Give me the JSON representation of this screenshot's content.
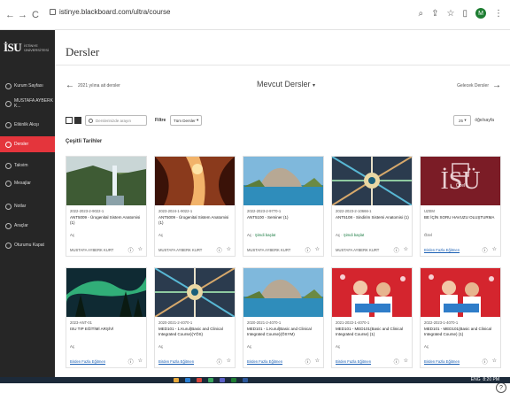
{
  "browser": {
    "url": "istinye.blackboard.com/ultra/course",
    "back": "←",
    "forward": "→",
    "reload": "C",
    "avatar_initial": "M"
  },
  "sidebar": {
    "logo_text": "İSU",
    "logo_sub_1": "İSTİNYE",
    "logo_sub_2": "ÜNİVERSİTESİ",
    "items": [
      {
        "label": "Kurum Sayfası"
      },
      {
        "label": "MUSTAFA AYBERK K..."
      },
      {
        "label": "Etkinlik Akışı"
      },
      {
        "label": "Dersler"
      },
      {
        "label": "Takvim"
      },
      {
        "label": "Mesajlar"
      },
      {
        "label": "Notlar"
      },
      {
        "label": "Araçlar"
      },
      {
        "label": "Oturumu Kapat"
      }
    ]
  },
  "main": {
    "title": "Dersler",
    "pager": {
      "prev": "2021 yılına ait dersler",
      "current": "Mevcut Dersler",
      "next": "Gelecek Dersler"
    },
    "search_placeholder": "Derslerinizde arayın",
    "filter_label": "Filtre",
    "filter_value": "Tüm Dersler",
    "perpage_value": "25",
    "perpage_label": "öğe/sayfa",
    "section_title": "Çeşitli Tarihler",
    "courses": [
      {
        "code": "2022-2023-2-9022-1",
        "name": "ANT5009 - Ürogenital Sistem Anatomisi (1)",
        "status": "Aç",
        "status_link": "",
        "instructor": "MUSTAFA AYBERK KURT",
        "instr_link": false
      },
      {
        "code": "2023-2024-1-9022-1",
        "name": "ANT5009 - Ürogenital Sistem Anatomisi (1)",
        "status": "Aç",
        "status_link": "",
        "instructor": "MUSTAFA AYBERK KURT",
        "instr_link": false
      },
      {
        "code": "2022-2023-2-9770-1",
        "name": "ANT5100 - Seminer (1)",
        "status": "Aç · ",
        "status_link": "Şimdi başlat",
        "instructor": "MUSTAFA AYBERK KURT",
        "instr_link": false
      },
      {
        "code": "2022-2023-2-10666-1",
        "name": "ANT5108 - Sindirim Sistemi Anatomisi (1)",
        "status": "Aç · ",
        "status_link": "Şimdi başlat",
        "instructor": "MUSTAFA AYBERK KURT",
        "instr_link": false
      },
      {
        "code": "UZEM",
        "name": "BE İÇİN SORU HAVUZU OLUŞTURMA",
        "status": "Özel",
        "status_link": "",
        "instructor": "Birden Fazla Eğitmen",
        "instr_link": true
      },
      {
        "code": "2023-ANT-01",
        "name": "ISU TIP EĞİTİMİ ARŞİVİ",
        "status": "Aç",
        "status_link": "",
        "instructor": "Birden Fazla Eğitmen",
        "instr_link": true
      },
      {
        "code": "2020-2021-2-4070-1",
        "name": "MED101 - 1.Kurul(Basic and Clinical Integrated Course)(YÖS)",
        "status": "Aç",
        "status_link": "",
        "instructor": "Birden Fazla Eğitmen",
        "instr_link": true
      },
      {
        "code": "2020-2021-2-4070-1",
        "name": "MED101 - 1.Kurul(Basic and Clinical Integrated Course)(ÖSYM)",
        "status": "Aç",
        "status_link": "",
        "instructor": "Birden Fazla Eğitmen",
        "instr_link": true
      },
      {
        "code": "2021-2022-1-4070-1",
        "name": "MED101 - MED101(Basic and Clinical Integrated Course) (1)",
        "status": "Aç",
        "status_link": "",
        "instructor": "Birden Fazla Eğitmen",
        "instr_link": true
      },
      {
        "code": "2022-2023-1-4070-1",
        "name": "MED101 - MED101(Basic and Clinical Integrated Course) (1)",
        "status": "Aç",
        "status_link": "",
        "instructor": "Birden Fazla Eğitmen",
        "instr_link": true
      }
    ],
    "card_images": [
      "waterfall",
      "canyon",
      "lake-rock",
      "kaleidoscope",
      "isu-logo",
      "aurora",
      "kaleidoscope",
      "lake-rock",
      "people-red",
      "people-red"
    ],
    "isu_card_text": "İSÜ",
    "isu_card_sub": "Özel"
  },
  "taskbar": {
    "lang": "ENG",
    "time": "8:20 PM"
  },
  "help": "?"
}
